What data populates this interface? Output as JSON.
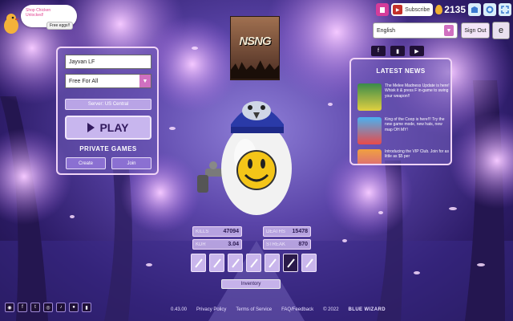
{
  "speech": {
    "line1": "Shop Chicken",
    "line2": "Unlocked!",
    "free_eggs": "Free eggs!!"
  },
  "topbar": {
    "subscribe_label": "Subscribe",
    "egg_count": "2135"
  },
  "language": {
    "selected": "English"
  },
  "account": {
    "sign_out_label": "Sign Out",
    "avatar_letter": "e"
  },
  "play_panel": {
    "name_value": "Jayvan LF",
    "mode_selected": "Free For All",
    "server_label": "Server: US Central",
    "play_label": "PLAY",
    "private_title": "PRIVATE GAMES",
    "create_label": "Create",
    "join_label": "Join"
  },
  "logo": {
    "text": "NSNG"
  },
  "news": {
    "title": "LATEST NEWS",
    "items": [
      {
        "text": "The Melee Madness Update is here! Whisk it & press F in-game to swing your weapon!!",
        "color": "#2a7a3c"
      },
      {
        "text": "King of the Coop is here!!! Try the new game mode, new hats, new map OH MY!",
        "color": "#3a9ae0"
      },
      {
        "text": "Introducing the VIP Club. Join for as little as $5 per",
        "color": "#e2832a"
      }
    ]
  },
  "stats": {
    "kills_label": "KILLS",
    "kills": "47094",
    "deaths_label": "DEATHS",
    "deaths": "15478",
    "kdr_label": "KDR",
    "kdr": "3.04",
    "streak_label": "STREAK",
    "streak": "870"
  },
  "inventory_label": "Inventory",
  "footer": {
    "version": "0.43.00",
    "privacy": "Privacy Policy",
    "terms": "Terms of Service",
    "faq": "FAQ/Feedback",
    "copyright": "© 2022",
    "brand": "BLUE WIZARD"
  },
  "colors": {
    "accent": "#d070c0",
    "panel_border": "#f0d4f6"
  }
}
